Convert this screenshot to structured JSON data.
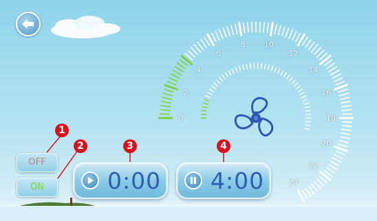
{
  "controls": {
    "off_label": "OFF",
    "on_label": "ON",
    "run_time": "0:00",
    "pause_time": "4:00"
  },
  "badges": [
    "1",
    "2",
    "3",
    "4"
  ],
  "gauge": {
    "labels": [
      "0",
      "2",
      "4",
      "6",
      "8",
      "10",
      "12",
      "14",
      "16",
      "18",
      "20",
      "22",
      "24"
    ],
    "active_level": 4,
    "inner_active_level": 2
  },
  "colors": {
    "accent_text": "#2d5db5",
    "off_text": "#c8817a",
    "on_text": "#79d628",
    "badge": "#d8121b",
    "gauge_active": "#7dd23a",
    "fan": "#2c57b3"
  },
  "icons": {
    "back": "back-arrow-icon",
    "play": "play-icon",
    "pause": "pause-icon",
    "fan": "fan-icon"
  }
}
